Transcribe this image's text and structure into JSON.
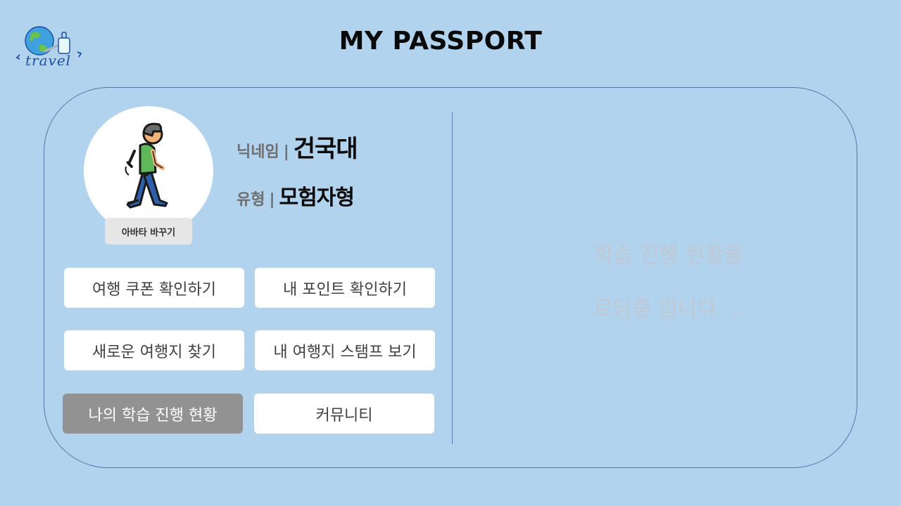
{
  "logo": {
    "text": "travel"
  },
  "header": {
    "title": "MY PASSPORT"
  },
  "profile": {
    "avatar_button": "아바타 바꾸기",
    "nickname_label": "닉네임",
    "nickname_value": "건국대",
    "type_label": "유형",
    "type_value": "모험자형",
    "separator": "|"
  },
  "menu": {
    "coupon": "여행 쿠폰 확인하기",
    "points": "내 포인트 확인하기",
    "new_destination": "새로운 여행지 찾기",
    "stamps": "내 여행지 스탬프 보기",
    "progress": "나의 학습 진행 현황",
    "community": "커뮤니티"
  },
  "status": {
    "line1": "학습 진행 현황을",
    "line2": "로딩중 입니다…."
  },
  "colors": {
    "background": "#b2d3ee",
    "active_button": "#929292",
    "card_border": "#5577a8"
  }
}
